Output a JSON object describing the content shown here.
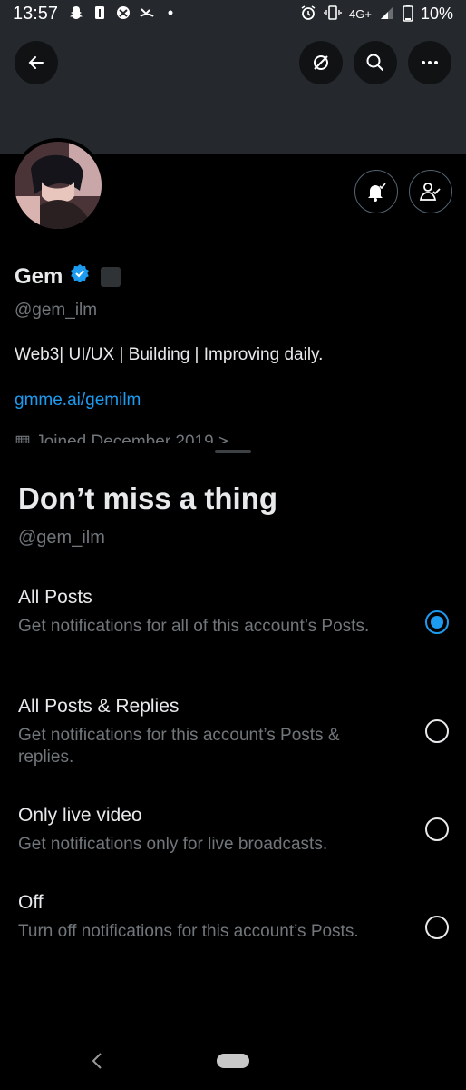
{
  "status_bar": {
    "time": "13:57",
    "network": "4G+",
    "battery": "10%"
  },
  "header": {
    "icons": [
      "back-arrow-icon",
      "translate-off-icon",
      "search-icon",
      "more-icon"
    ]
  },
  "profile": {
    "name": "Gem",
    "handle": "@gem_ilm",
    "bio": "Web3| UI/UX | Building | Improving daily.",
    "link": "gmme.ai/gemilm",
    "joined": "Joined December 2019 >"
  },
  "sheet": {
    "title": "Don’t miss a thing",
    "handle": "@gem_ilm",
    "options": [
      {
        "title": "All Posts",
        "description": "Get notifications for all of this account’s Posts.",
        "selected": true
      },
      {
        "title": "All Posts & Replies",
        "description": "Get notifications for this account’s Posts & replies.",
        "selected": false
      },
      {
        "title": "Only live video",
        "description": "Get notifications only for live broadcasts.",
        "selected": false
      },
      {
        "title": "Off",
        "description": "Turn off notifications for this account’s Posts.",
        "selected": false
      }
    ]
  },
  "colors": {
    "accent": "#1d9bf0",
    "background": "#000000",
    "banner": "#25292d",
    "secondary_text": "#71767b"
  }
}
